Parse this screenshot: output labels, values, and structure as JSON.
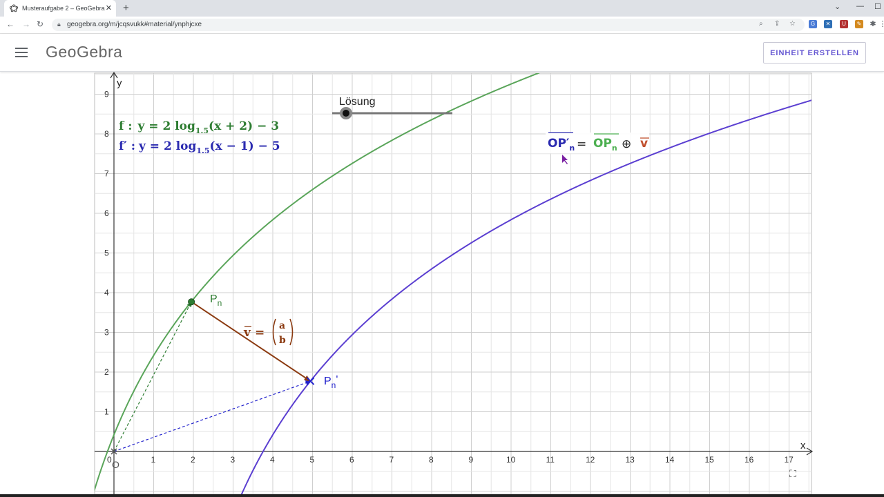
{
  "browser": {
    "tab_title": "Musteraufgabe 2 – GeoGebra",
    "tab_close": "✕",
    "new_tab": "+",
    "url": "geogebra.org/m/jcqsvukk#material/ynphjcxe",
    "window_controls": [
      "⌄",
      "—",
      "☐",
      "✕"
    ]
  },
  "header": {
    "logo_text": "GeoGebra",
    "create_button": "EINHEIT ERSTELLEN"
  },
  "applet": {
    "x_axis_label": "x",
    "y_axis_label": "y",
    "origin_label": "O",
    "slider_label": "Lösung",
    "point_p": "P",
    "point_p_sub": "n",
    "point_p_prime": "P",
    "point_p_prime_sub": "n",
    "point_p_prime_mark": "'",
    "vector_label": "v",
    "vector_a": "a",
    "vector_b": "b",
    "eq_f_name": "f :",
    "eq_f_body": "y = 2 log",
    "eq_f_base": "1.5",
    "eq_f_arg": "(x + 2) − 3",
    "eq_fp_name": "f′ :",
    "eq_fp_body": "y = 2 log",
    "eq_fp_base": "1.5",
    "eq_fp_arg": "(x − 1) − 5",
    "rel_lhs": "OP′",
    "rel_lhs_sub": "n",
    "rel_eq": "=",
    "rel_rhs": "OP",
    "rel_rhs_sub": "n",
    "rel_op": "⊕",
    "rel_v": "v",
    "colors": {
      "green": "#2e7d32",
      "curve_green": "#5aa55a",
      "blue": "#5b3fd1",
      "brown": "#8b3a10",
      "red": "#c0502e"
    }
  },
  "chart_data": {
    "type": "line",
    "title": "",
    "xlabel": "x",
    "ylabel": "y",
    "xlim": [
      0,
      17.6
    ],
    "ylim": [
      0,
      9.5
    ],
    "x_ticks": [
      0,
      1,
      2,
      3,
      4,
      5,
      6,
      7,
      8,
      9,
      10,
      11,
      12,
      13,
      14,
      15,
      16,
      17
    ],
    "y_ticks": [
      1,
      2,
      3,
      4,
      5,
      6,
      7,
      8,
      9
    ],
    "grid": true,
    "series": [
      {
        "name": "f",
        "formula": "y = 2 log_1.5(x + 2) - 3",
        "color": "#5aa55a"
      },
      {
        "name": "f'",
        "formula": "y = 2 log_1.5(x - 1) - 5",
        "color": "#5b3fd1"
      }
    ],
    "points": [
      {
        "label": "Pn",
        "x": 1.95,
        "y": 3.77
      },
      {
        "label": "Pn'",
        "x": 4.95,
        "y": 1.77
      },
      {
        "label": "O",
        "x": 0,
        "y": 0
      }
    ],
    "vector": {
      "from": [
        1.95,
        3.77
      ],
      "to": [
        4.95,
        1.77
      ]
    }
  }
}
